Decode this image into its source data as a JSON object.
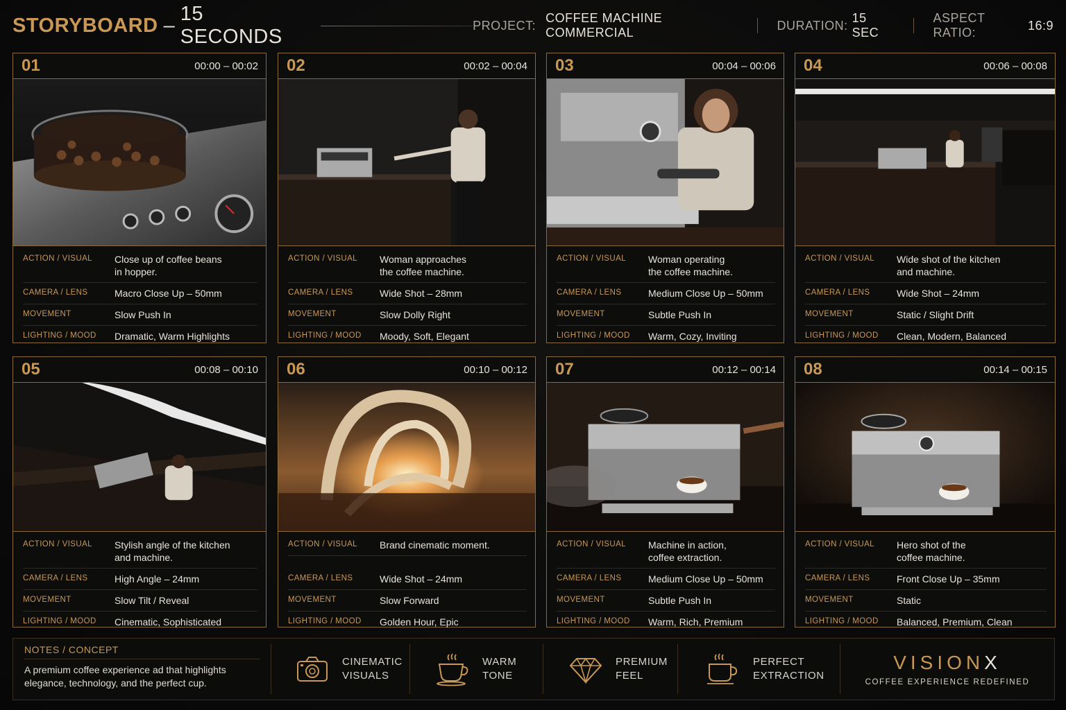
{
  "header": {
    "title_main": "STORYBOARD",
    "title_sep": "–",
    "title_sub": "15 SECONDS",
    "project_label": "PROJECT:",
    "project_value": "COFFEE MACHINE COMMERCIAL",
    "duration_label": "DURATION:",
    "duration_value": "15 SEC",
    "aspect_label": "ASPECT RATIO:",
    "aspect_value": "16:9"
  },
  "row_labels": {
    "action": "ACTION / VISUAL",
    "camera": "CAMERA / LENS",
    "movement": "MOVEMENT",
    "lighting": "LIGHTING / MOOD"
  },
  "panels": [
    {
      "num": "01",
      "time": "00:00 – 00:02",
      "image": "coffee beans in hopper close-up",
      "action": "Close up of coffee beans\nin hopper.",
      "camera": "Macro Close Up – 50mm",
      "movement": "Slow Push In",
      "lighting": "Dramatic, Warm Highlights"
    },
    {
      "num": "02",
      "time": "00:02 – 00:04",
      "image": "woman approaching coffee machine in dark kitchen",
      "action": "Woman approaches\nthe coffee machine.",
      "camera": "Wide Shot – 28mm",
      "movement": "Slow Dolly Right",
      "lighting": "Moody, Soft, Elegant"
    },
    {
      "num": "03",
      "time": "00:04 – 00:06",
      "image": "woman operating espresso machine",
      "action": "Woman operating\nthe coffee machine.",
      "camera": "Medium Close Up – 50mm",
      "movement": "Subtle Push In",
      "lighting": "Warm, Cozy, Inviting"
    },
    {
      "num": "04",
      "time": "00:06 – 00:08",
      "image": "wide shot of kitchen and machine",
      "action": "Wide shot of the kitchen\nand machine.",
      "camera": "Wide Shot – 24mm",
      "movement": "Static / Slight Drift",
      "lighting": "Clean, Modern, Balanced"
    },
    {
      "num": "05",
      "time": "00:08 – 00:10",
      "image": "high angle view of kitchen and machine",
      "action": "Stylish angle of the kitchen\nand machine.",
      "camera": "High Angle – 24mm",
      "movement": "Slow Tilt / Reveal",
      "lighting": "Cinematic, Sophisticated"
    },
    {
      "num": "06",
      "time": "00:10 – 00:12",
      "image": "brand arches at sunset",
      "action": "Brand cinematic moment.",
      "camera": "Wide Shot – 24mm",
      "movement": "Slow Forward",
      "lighting": "Golden Hour, Epic"
    },
    {
      "num": "07",
      "time": "00:12 – 00:14",
      "image": "machine extracting coffee with steam",
      "action": "Machine in action,\ncoffee extraction.",
      "camera": "Medium Close Up – 50mm",
      "movement": "Subtle Push In",
      "lighting": "Warm, Rich, Premium"
    },
    {
      "num": "08",
      "time": "00:14 – 00:15",
      "image": "hero shot of espresso machine",
      "action": "Hero shot of the\ncoffee machine.",
      "camera": "Front Close Up – 35mm",
      "movement": "Static",
      "lighting": "Balanced, Premium, Clean"
    }
  ],
  "footer": {
    "notes_title": "NOTES / CONCEPT",
    "notes_body": "A premium coffee experience ad that highlights elegance, technology, and the perfect cup.",
    "features": [
      {
        "icon": "camera-icon",
        "label": "CINEMATIC\nVISUALS"
      },
      {
        "icon": "coffee-cup-icon",
        "label": "WARM\nTONE"
      },
      {
        "icon": "diamond-icon",
        "label": "PREMIUM\nFEEL"
      },
      {
        "icon": "steaming-cup-icon",
        "label": "PERFECT\nEXTRACTION"
      }
    ],
    "brand_name_a": "VISION",
    "brand_name_b": "X",
    "brand_tagline": "COFFEE EXPERIENCE REDEFINED"
  },
  "colors": {
    "accent": "#c99855",
    "background": "#0b0b0b",
    "text": "#e8e4dc",
    "border": "#8a6a3a"
  }
}
